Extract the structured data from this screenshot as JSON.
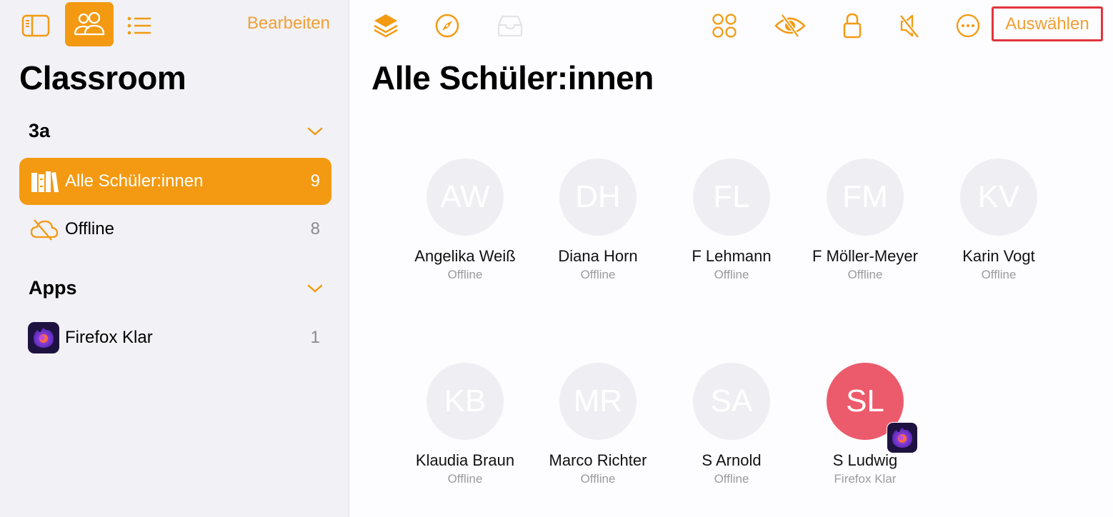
{
  "sidebar": {
    "toolbar": {
      "sidebar_toggle_icon": "sidebar-icon",
      "students_view_icon": "people-icon",
      "list_view_icon": "list-icon",
      "edit_label": "Bearbeiten"
    },
    "title": "Classroom",
    "sections": [
      {
        "label": "3a",
        "items": [
          {
            "label": "Alle Schüler:innen",
            "count": "9",
            "icon": "books-icon",
            "selected": true
          },
          {
            "label": "Offline",
            "count": "8",
            "icon": "cloud-offline-icon",
            "selected": false
          }
        ]
      },
      {
        "label": "Apps",
        "items": [
          {
            "label": "Firefox Klar",
            "count": "1",
            "icon": "firefox-klar-icon",
            "selected": false
          }
        ]
      }
    ]
  },
  "main": {
    "toolbar": {
      "icons": [
        "layers-icon",
        "compass-icon",
        "tray-icon",
        "groups-icon",
        "hide-screen-icon",
        "lock-icon",
        "mute-icon",
        "more-icon"
      ],
      "select_label": "Auswählen"
    },
    "title": "Alle Schüler:innen",
    "students": [
      {
        "initials": "AW",
        "name": "Angelika Weiß",
        "status": "Offline",
        "active": false
      },
      {
        "initials": "DH",
        "name": "Diana Horn",
        "status": "Offline",
        "active": false
      },
      {
        "initials": "FL",
        "name": "F Lehmann",
        "status": "Offline",
        "active": false
      },
      {
        "initials": "FM",
        "name": "F Möller-Meyer",
        "status": "Offline",
        "active": false
      },
      {
        "initials": "KV",
        "name": "Karin Vogt",
        "status": "Offline",
        "active": false
      },
      {
        "initials": "KB",
        "name": "Klaudia Braun",
        "status": "Offline",
        "active": false
      },
      {
        "initials": "MR",
        "name": "Marco Richter",
        "status": "Offline",
        "active": false
      },
      {
        "initials": "SA",
        "name": "S Arnold",
        "status": "Offline",
        "active": false
      },
      {
        "initials": "SL",
        "name": "S Ludwig",
        "status": "Firefox Klar",
        "active": true
      }
    ]
  },
  "colors": {
    "accent": "#f39a12",
    "accent_text": "#f0a033",
    "active_avatar": "#ec5b6c",
    "highlight_border": "#e2343d",
    "sidebar_bg": "#f2f1f6"
  }
}
